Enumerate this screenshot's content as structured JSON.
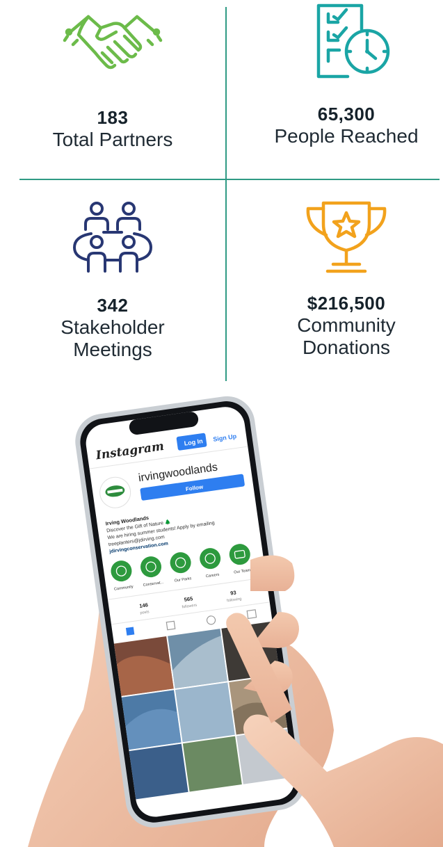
{
  "stats": [
    {
      "value": "183",
      "label": "Total Partners",
      "icon": "handshake-icon",
      "color": "#6cbb4a"
    },
    {
      "value": "65,300",
      "label": "People Reached",
      "icon": "checklist-clock-icon",
      "color": "#1aa5a5"
    },
    {
      "value": "342",
      "label": "Stakeholder Meetings",
      "label_line1": "Stakeholder",
      "label_line2": "Meetings",
      "icon": "meeting-table-icon",
      "color": "#283773"
    },
    {
      "value": "$216,500",
      "label": "Community Donations",
      "label_line1": "Community",
      "label_line2": "Donations",
      "icon": "trophy-icon",
      "color": "#f2a21c"
    }
  ],
  "phone": {
    "app_name": "Instagram",
    "login_label": "Log In",
    "signup_label": "Sign Up",
    "username": "irvingwoodlands",
    "follow_label": "Follow",
    "profile_name": "Irving Woodlands",
    "bio_line1": "Discover the Gift of Nature 🌲",
    "bio_line2": "We are hiring summer students! Apply by emailing",
    "bio_line3": "treeplanters@jdirving.com",
    "link": "jdirvingconservation.com",
    "highlights": [
      "Community",
      "Conservat...",
      "Our Parks",
      "Careers",
      "Our Team"
    ],
    "counts": [
      {
        "value": "146",
        "label": "posts"
      },
      {
        "value": "565",
        "label": "followers"
      },
      {
        "value": "93",
        "label": "following"
      }
    ]
  }
}
